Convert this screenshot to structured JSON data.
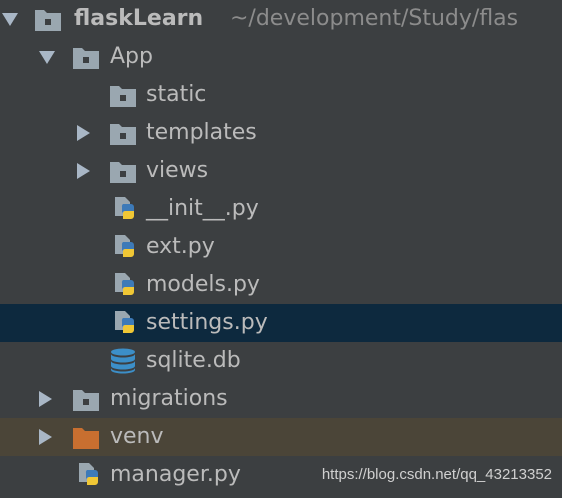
{
  "colors": {
    "background": "#3c3f41",
    "selected_row": "#0d293e",
    "excluded_row": "#4b4538",
    "folder": "#9aa7b0",
    "excluded_folder": "#c86f30",
    "python_blue": "#3d7ab8",
    "python_yellow": "#f0c735",
    "db_blue": "#3c8fc8",
    "text": "#bbbbbb"
  },
  "project": {
    "name": "flaskLearn",
    "path": "~/development/Study/flas"
  },
  "tree": {
    "app": {
      "label": "App",
      "icon": "module-folder-icon"
    },
    "static": {
      "label": "static",
      "icon": "folder-icon"
    },
    "templates": {
      "label": "templates",
      "icon": "folder-icon"
    },
    "views": {
      "label": "views",
      "icon": "folder-icon"
    },
    "init_py": {
      "label": "__init__.py",
      "icon": "python-file-icon"
    },
    "ext_py": {
      "label": "ext.py",
      "icon": "python-file-icon"
    },
    "models_py": {
      "label": "models.py",
      "icon": "python-file-icon"
    },
    "settings_py": {
      "label": "settings.py",
      "icon": "python-file-icon",
      "selected": true
    },
    "sqlite_db": {
      "label": "sqlite.db",
      "icon": "database-icon"
    },
    "migrations": {
      "label": "migrations",
      "icon": "module-folder-icon"
    },
    "venv": {
      "label": "venv",
      "icon": "excluded-folder-icon"
    },
    "manager_py": {
      "label": "manager.py",
      "icon": "python-file-icon"
    }
  },
  "watermark": "https://blog.csdn.net/qq_43213352"
}
